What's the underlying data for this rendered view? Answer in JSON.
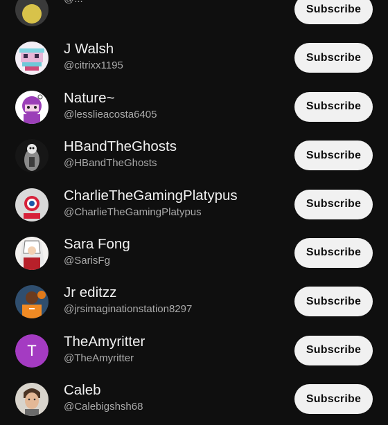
{
  "subscribe_label": "Subscribe",
  "channels": [
    {
      "name": "",
      "handle": "@...",
      "avatar_icon": "partial-avatar-icon"
    },
    {
      "name": "J Walsh",
      "handle": "@citrixx1195",
      "avatar_icon": "pixel-art-avatar-icon"
    },
    {
      "name": "Nature~",
      "handle": "@lesslieacosta6405",
      "avatar_icon": "purple-character-avatar-icon"
    },
    {
      "name": "HBandTheGhosts",
      "handle": "@HBandTheGhosts",
      "avatar_icon": "dark-figure-avatar-icon"
    },
    {
      "name": "CharlieTheGamingPlatypus",
      "handle": "@CharlieTheGamingPlatypus",
      "avatar_icon": "club-crest-avatar-icon"
    },
    {
      "name": "Sara Fong",
      "handle": "@SarisFg",
      "avatar_icon": "anime-character-avatar-icon"
    },
    {
      "name": "Jr editzz",
      "handle": "@jrsimaginationstation8297",
      "avatar_icon": "basketball-player-avatar-icon"
    },
    {
      "name": "TheAmyritter",
      "handle": "@TheAmyritter",
      "avatar_icon": "letter-avatar-icon",
      "avatar_letter": "T",
      "avatar_color": "#a43bc2"
    },
    {
      "name": "Caleb",
      "handle": "@Calebigshsh68",
      "avatar_icon": "person-photo-avatar-icon"
    }
  ],
  "colors": {
    "background": "#0f0f0f",
    "button_bg": "#f1f1f1",
    "button_text": "#0f0f0f",
    "name_text": "#f1f1f1",
    "handle_text": "#aaaaaa"
  }
}
